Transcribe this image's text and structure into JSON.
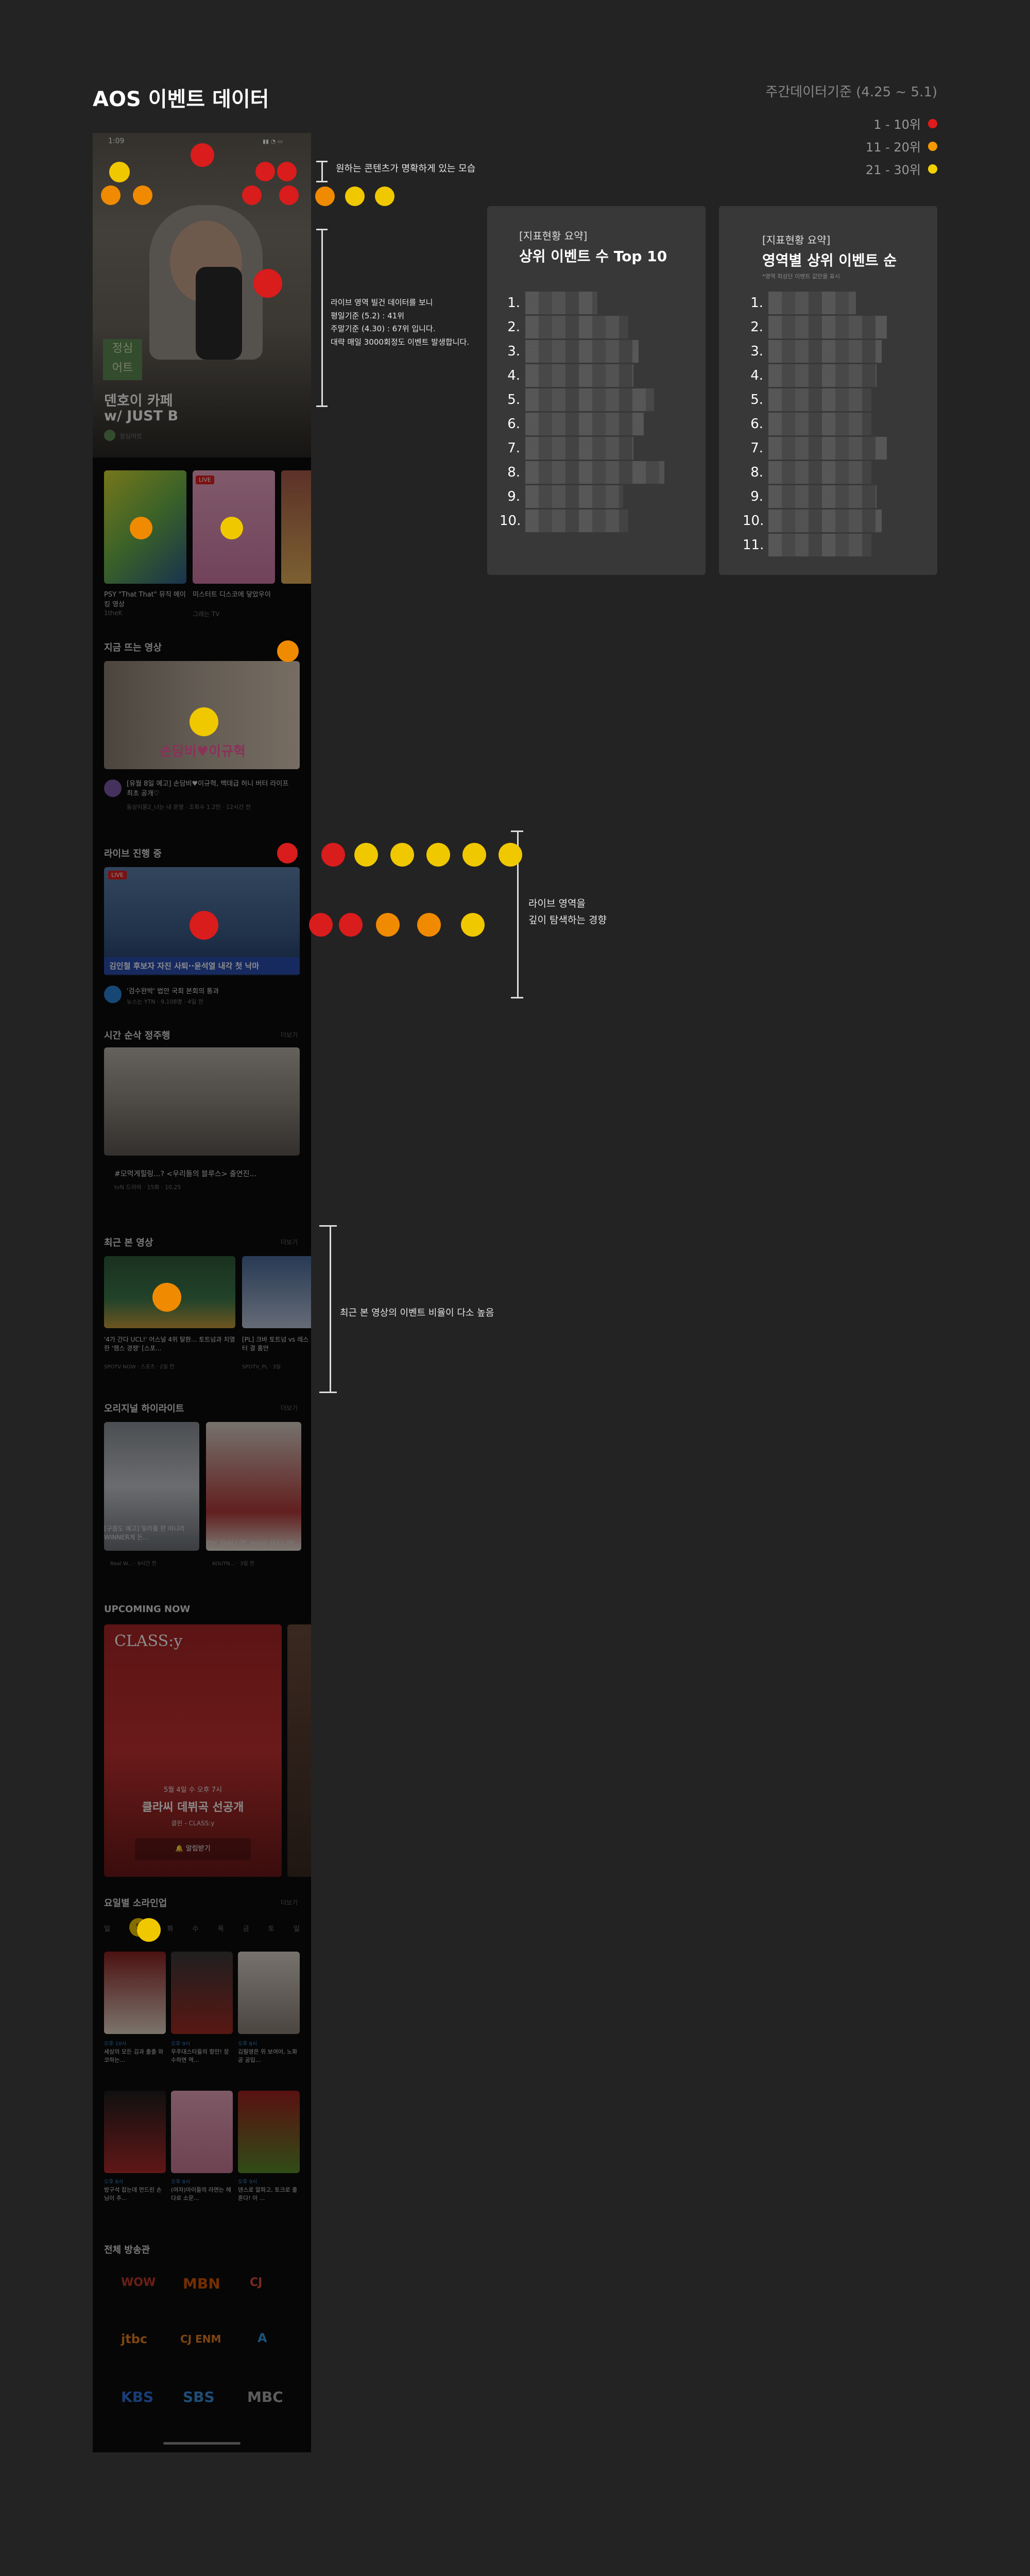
{
  "header": {
    "title": "AOS 이벤트 데이터",
    "period": "주간데이터기준 (4.25 ~ 5.1)",
    "legend": [
      {
        "label": "1 - 10위",
        "color": "#e01b1b"
      },
      {
        "label": "11 - 20위",
        "color": "#f59a00"
      },
      {
        "label": "21 - 30위",
        "color": "#f2d000"
      }
    ]
  },
  "annotations": {
    "a1": "원하는 콘텐츠가 명확하게 있는 모습",
    "a2_l1": "라이브 영역 빌건 데이터를 보니",
    "a2_l2": "평일기준 (5.2) : 41위",
    "a2_l3": "주말기준 (4.30) : 67위 입니다.",
    "a2_l4": "대략 매일 3000회정도 이벤트 발생합니다.",
    "a3_l1": "라이브 영역을",
    "a3_l2": "깊이 탐색하는 경향",
    "a4": "최근 본 영상의 이벤트 비율이 다소 높음"
  },
  "cards": {
    "left": {
      "label": "[지표현황 요약]",
      "title": "상위 이벤트 수 Top 10",
      "ranks": [
        "1.",
        "2.",
        "3.",
        "4.",
        "5.",
        "6.",
        "7.",
        "8.",
        "9.",
        "10."
      ]
    },
    "right": {
      "label": "[지표현황 요약]",
      "title": "영역별 상위 이벤트 순",
      "note": "*영역 최상단 이벤트 값만을 표시",
      "ranks": [
        "1.",
        "2.",
        "3.",
        "4.",
        "5.",
        "6.",
        "7.",
        "8.",
        "9.",
        "10.",
        "11."
      ]
    }
  },
  "phone": {
    "status_time": "1:09",
    "hero": {
      "title_line1": "덴호이 카페",
      "title_line2": "w/ JUST B",
      "channel": "정심어트",
      "badge": "정심\n어트"
    },
    "row1": [
      {
        "title": "PSY \"That That\" 뮤직 메이킹 영상",
        "channel": "1theK"
      },
      {
        "title": "미스터트 디스코에 닿았우이",
        "channel": "그레는 TV"
      },
      {
        "title": "",
        "channel": ""
      }
    ],
    "trending": {
      "title": "지금 뜨는 영상",
      "video_title": "[유월 8일 예고] 손담비♥이규혁, 백데급 허니 버터 라이프 최초 공개♡",
      "meta": "동상이몽2_너는 내 운명 · 조회수 1.2만 · 12시간 전"
    },
    "live": {
      "title": "라이브 진행 중",
      "caption": "김인철 후보자 자진 사퇴··윤석열 내각 첫 낙마",
      "video_title": "'검수완박' 법안 국회 본회의 통과",
      "meta": "뉴스는 YTN · 9,108명 · 4일 전",
      "badge": "LIVE"
    },
    "realtime": {
      "title": "시간 순삭 정주행",
      "more": "더보기",
      "video_title": "#모먹게힐링...? <우리들의 블루스> 출연진...",
      "meta": "tvN 드라마 · 15화 · 10,25"
    },
    "recent": {
      "title": "최근 본 영상",
      "more": "더보기",
      "items": [
        {
          "title": "'4가 간다 UCL!' 어스널 4위 탈환... 토트넘과 치열한 '챔스 경쟁' [스포...",
          "channel": "SPOTV NOW · 스포츠 · 2일 전"
        },
        {
          "title": "[PL] 크바 토트넘 vs 레스터 결 홈만",
          "channel": "SPOTV_PL · 3일"
        }
      ]
    },
    "original": {
      "title": "오리지널 하이라이트",
      "more": "더보기",
      "items": [
        {
          "title": "[구름도 예고] 밀라를 한 아니라WINNER게 든...",
          "channel": "Real W... · 9시간 전"
        },
        {
          "title": "PSY 'GIALI (ft. Jessi)' FULL PE...",
          "channel": "KOUTN... · 3일 전"
        }
      ]
    },
    "upcoming": {
      "title": "UPCOMING NOW",
      "brand": "CLASS:y",
      "date": "5월 4일 수 오후 7시",
      "headline": "클라씨 데뷔곡 선공개",
      "sub": "클핀 - CLASS:y",
      "button": "알림받기"
    },
    "weekly": {
      "title": "요일별 소라인업",
      "more": "더보기",
      "days": [
        "일",
        "월",
        "화",
        "수",
        "목",
        "금",
        "토",
        "일"
      ],
      "row1": [
        {
          "day": "오후 10시",
          "title": "세상의 모든 김과 출출 와코하는..."
        },
        {
          "day": "오후 9시",
          "title": "우주대스타들의 항만! 장수하면 역..."
        },
        {
          "day": "오후 8시",
          "title": "김필영은 위 보여어, 노화공 공입..."
        }
      ],
      "row2": [
        {
          "day": "오후 8시",
          "title": "방구석 잡는데 먼드린 손님이 추..."
        },
        {
          "day": "오후 8시",
          "title": "(여자)아이들의 라면는 헤다로 소문..."
        },
        {
          "day": "오후 9시",
          "title": "댄스로 알파고, 토크로 출혼다! 아 ..."
        }
      ]
    },
    "broadcasters": {
      "title": "전체 방송관",
      "logos": [
        "WOW",
        "MBN",
        "CJ",
        "jtbc",
        "CJ ENM",
        "A",
        "KBS",
        "SBS",
        "MBC"
      ]
    }
  }
}
